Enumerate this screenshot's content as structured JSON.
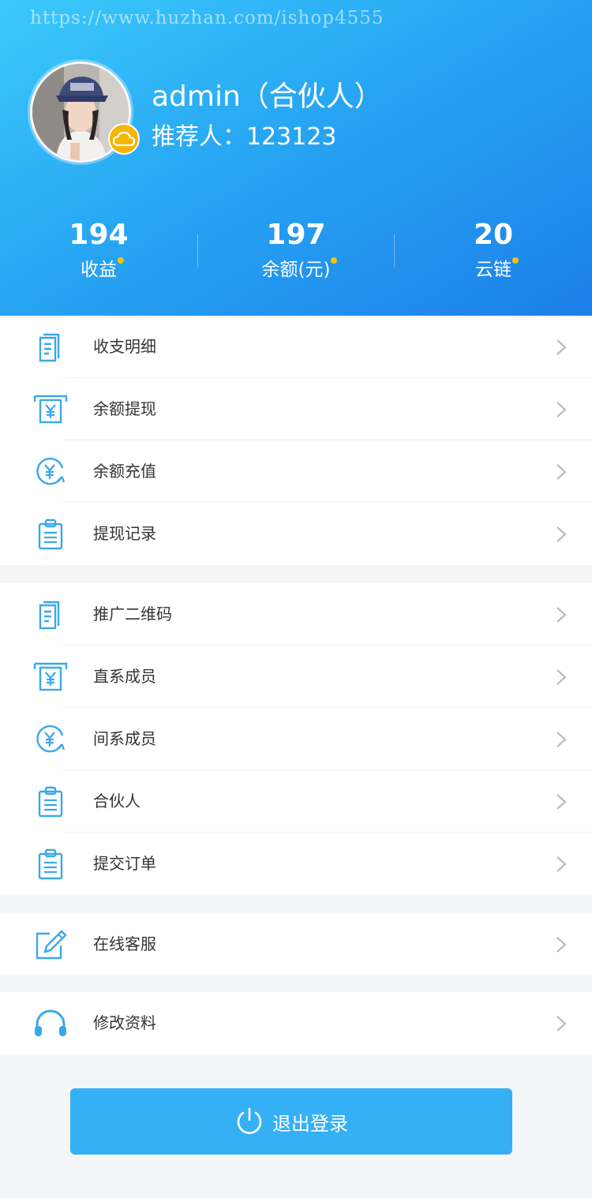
{
  "watermark": "https://www.huzhan.com/ishop4555",
  "profile": {
    "username": "admin（合伙人）",
    "referrer": "推荐人：123123"
  },
  "stats": [
    {
      "value": "194",
      "label": "收益"
    },
    {
      "value": "197",
      "label": "余额(元)"
    },
    {
      "value": "20",
      "label": "云链"
    }
  ],
  "menu_group_1": [
    {
      "label": "收支明细",
      "icon": "document-icon"
    },
    {
      "label": "余额提现",
      "icon": "atm-withdraw-icon"
    },
    {
      "label": "余额充值",
      "icon": "yuan-recharge-icon"
    },
    {
      "label": "提现记录",
      "icon": "clipboard-icon"
    }
  ],
  "menu_group_2": [
    {
      "label": "推广二维码",
      "icon": "document-icon"
    },
    {
      "label": "直系成员",
      "icon": "atm-withdraw-icon"
    },
    {
      "label": "间系成员",
      "icon": "yuan-recharge-icon"
    },
    {
      "label": "合伙人",
      "icon": "clipboard-icon"
    },
    {
      "label": "提交订单",
      "icon": "clipboard-icon"
    }
  ],
  "menu_group_3": [
    {
      "label": "在线客服",
      "icon": "edit-icon"
    }
  ],
  "menu_group_4": [
    {
      "label": "修改资料",
      "icon": "headphones-icon"
    }
  ],
  "logout_label": "退出登录",
  "colors": {
    "header_start": "#3cc9fb",
    "header_end": "#1c7fe9",
    "icon_blue": "#3aa8ea",
    "badge_yellow": "#f7b500",
    "logout_bg": "#35b0f4"
  }
}
